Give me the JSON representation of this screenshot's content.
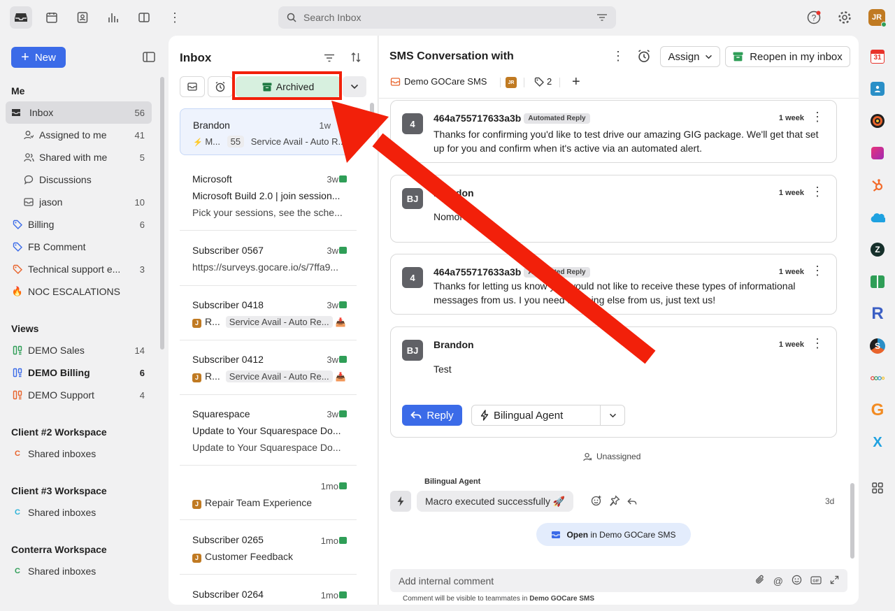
{
  "search": {
    "placeholder": "Search Inbox"
  },
  "user_initials": "JR",
  "sidebar": {
    "new_label": "New",
    "me_title": "Me",
    "me_items": [
      {
        "label": "Inbox",
        "count": "56"
      },
      {
        "label": "Assigned to me",
        "count": "41"
      },
      {
        "label": "Shared with me",
        "count": "5"
      },
      {
        "label": "Discussions",
        "count": ""
      },
      {
        "label": "jason",
        "count": "10"
      },
      {
        "label": "Billing",
        "count": "6"
      },
      {
        "label": "FB Comment",
        "count": ""
      },
      {
        "label": "Technical support e...",
        "count": "3"
      },
      {
        "label": "NOC ESCALATIONS",
        "count": ""
      }
    ],
    "views_title": "Views",
    "views": [
      {
        "label": "DEMO Sales",
        "count": "14"
      },
      {
        "label": "DEMO Billing",
        "count": "6"
      },
      {
        "label": "DEMO Support",
        "count": "4"
      }
    ],
    "workspaces": [
      {
        "title": "Client #2 Workspace",
        "item": "Shared inboxes",
        "letter": "C",
        "color": "#e8632b"
      },
      {
        "title": "Client #3 Workspace",
        "item": "Shared inboxes",
        "letter": "C",
        "color": "#2bb3d9"
      },
      {
        "title": "Conterra Workspace",
        "item": "Shared inboxes",
        "letter": "C",
        "color": "#2f9e57"
      }
    ]
  },
  "list": {
    "title": "Inbox",
    "archived_label": "Archived",
    "items": [
      {
        "name": "Brandon",
        "time": "1w",
        "prefix": "M...",
        "count": "55",
        "tag": "Service Avail - Auto R..."
      },
      {
        "name": "Microsoft",
        "time": "3w",
        "subject": "Microsoft Build 2.0 | join session...",
        "preview": "Pick your sessions, see the sche..."
      },
      {
        "name": "Subscriber 0567",
        "time": "3w",
        "subject": "https://surveys.gocare.io/s/7ffa9..."
      },
      {
        "name": "Subscriber 0418",
        "time": "3w",
        "prefix": "R...",
        "tag": "Service Avail - Auto Re..."
      },
      {
        "name": "Subscriber 0412",
        "time": "3w",
        "prefix": "R...",
        "tag": "Service Avail - Auto Re..."
      },
      {
        "name": "Squarespace",
        "time": "3w",
        "subject": "Update to Your Squarespace Do...",
        "preview": "Update to Your Squarespace Do..."
      },
      {
        "name": "",
        "time": "1mo",
        "subject": "Repair Team Experience"
      },
      {
        "name": "Subscriber 0265",
        "time": "1mo",
        "subject": "Customer Feedback"
      },
      {
        "name": "Subscriber 0264",
        "time": "1mo"
      }
    ]
  },
  "conversation": {
    "title": "SMS Conversation with",
    "assign_label": "Assign",
    "reopen_label": "Reopen in my inbox",
    "inbox_name": "Demo GOCare SMS",
    "assignee_initials": "JR",
    "tag_count": "2",
    "messages": [
      {
        "avatar": "4",
        "author": "464a755717633a3b",
        "badge": "Automated Reply",
        "time": "1 week",
        "body": "Thanks for confirming you'd like to test drive our amazing GIG package. We'll get that set up for you and confirm when it's active via an automated alert."
      },
      {
        "avatar": "BJ",
        "author": "Brandon",
        "badge": "",
        "time": "1 week",
        "body": "Nomore"
      },
      {
        "avatar": "4",
        "author": "464a755717633a3b",
        "badge": "Automated Reply",
        "time": "1 week",
        "body": "Thanks for letting us know you would not like to receive these types of informational messages from us.  I you need anything else from us, just text us!"
      },
      {
        "avatar": "BJ",
        "author": "Brandon",
        "badge": "",
        "time": "1 week",
        "body": "Test"
      }
    ],
    "reply_label": "Reply",
    "agent_label": "Bilingual Agent",
    "unassigned": "Unassigned",
    "event_author": "Bilingual Agent",
    "event_text": "Macro executed successfully 🚀",
    "event_time": "3d",
    "open_strong": "Open",
    "open_rest": "in Demo GOCare SMS",
    "comment_placeholder": "Add internal comment",
    "comment_note_prefix": "Comment will be visible to teammates in",
    "comment_note_inbox": "Demo GOCare SMS"
  },
  "right_apps": [
    "31",
    "R",
    "G",
    "X"
  ]
}
